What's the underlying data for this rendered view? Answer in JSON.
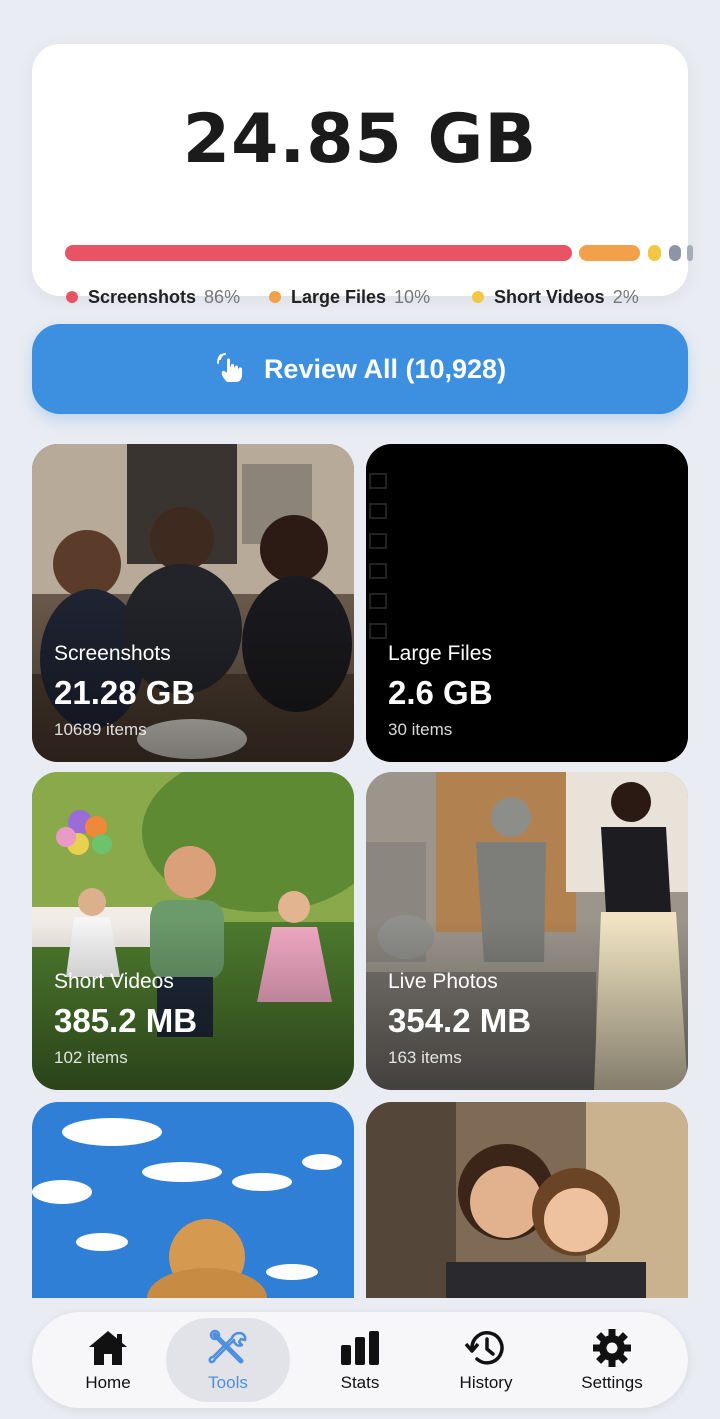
{
  "summary": {
    "total": "24.85 GB",
    "bar_segments": [
      {
        "name": "Screenshots",
        "fraction": 0.86,
        "color": "#e95464"
      },
      {
        "name": "Large Files",
        "fraction": 0.1,
        "color": "#f2a04a"
      },
      {
        "name": "Short Videos",
        "fraction": 0.02,
        "color": "#f2c744"
      },
      {
        "name": "other-1",
        "fraction": 0.01,
        "color": "#9aa0ab"
      },
      {
        "name": "other-2",
        "fraction": 0.01,
        "color": "#9aa0ab"
      }
    ],
    "legend": [
      {
        "label": "Screenshots",
        "percent": "86%",
        "color": "#e95464"
      },
      {
        "label": "Large Files",
        "percent": "10%",
        "color": "#f2a04a"
      },
      {
        "label": "Short Videos",
        "percent": "2%",
        "color": "#f2c744"
      }
    ]
  },
  "review": {
    "icon": "tap-hand-icon",
    "label": "Review All (10,928)"
  },
  "categories": [
    {
      "name": "Screenshots",
      "size": "21.28 GB",
      "count": "10689 items"
    },
    {
      "name": "Large Files",
      "size": "2.6 GB",
      "count": "30 items"
    },
    {
      "name": "Short Videos",
      "size": "385.2 MB",
      "count": "102 items"
    },
    {
      "name": "Live Photos",
      "size": "354.2 MB",
      "count": "163 items"
    }
  ],
  "nav": {
    "items": [
      {
        "label": "Home",
        "icon": "home-icon"
      },
      {
        "label": "Tools",
        "icon": "tools-icon",
        "active": true
      },
      {
        "label": "Stats",
        "icon": "bar-chart-icon"
      },
      {
        "label": "History",
        "icon": "history-icon"
      },
      {
        "label": "Settings",
        "icon": "gear-icon"
      }
    ],
    "active_color": "#4f8fdf"
  },
  "colors": {
    "accent": "#3d8fe0",
    "background": "#e9ecf3"
  }
}
